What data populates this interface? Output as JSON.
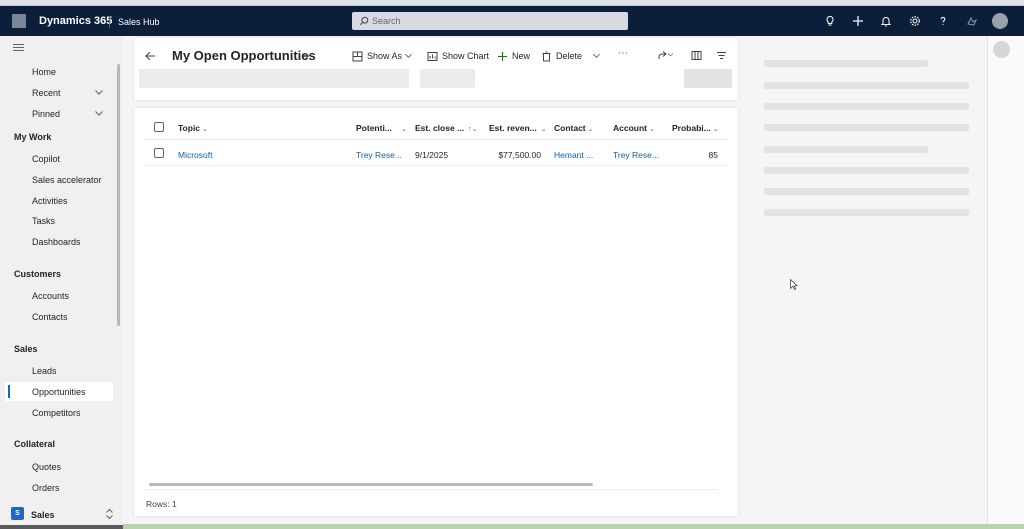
{
  "app": {
    "name": "Dynamics 365",
    "module": "Sales Hub"
  },
  "search": {
    "placeholder": "Search"
  },
  "sidebar": {
    "items_top": [
      "Home",
      "Recent",
      "Pinned"
    ],
    "groups": [
      {
        "title": "My Work",
        "items": [
          "Copilot",
          "Sales accelerator",
          "Activities",
          "Tasks",
          "Dashboards"
        ]
      },
      {
        "title": "Customers",
        "items": [
          "Accounts",
          "Contacts"
        ]
      },
      {
        "title": "Sales",
        "items": [
          "Leads",
          "Opportunities",
          "Competitors"
        ]
      },
      {
        "title": "Collateral",
        "items": [
          "Quotes",
          "Orders"
        ]
      }
    ],
    "active_item": "Opportunities",
    "area": {
      "badge": "S",
      "label": "Sales"
    }
  },
  "commandbar": {
    "view_title": "My Open Opportunities",
    "show_as": "Show As",
    "show_chart": "Show Chart",
    "new": "New",
    "delete": "Delete",
    "more": "⋯"
  },
  "grid": {
    "columns": [
      "Topic",
      "Potenti...",
      "Est. close ...",
      "Est. reven...",
      "Contact",
      "Account",
      "Probabi..."
    ],
    "rows": [
      [
        "Microsoft",
        "Trey Rese...",
        "9/1/2025",
        "$77,500.00",
        "Hemant ...",
        "Trey Rese...",
        "85"
      ]
    ],
    "footer": "Rows: 1"
  },
  "icons": {
    "topbar": [
      "lightbulb-icon",
      "plus-icon",
      "bell-icon",
      "settings-icon",
      "help-icon",
      "copilot-icon",
      "avatar"
    ]
  },
  "colors": {
    "topbar": "#0b1f3a",
    "accent": "#0f6cbd",
    "link": "#115ea3"
  }
}
